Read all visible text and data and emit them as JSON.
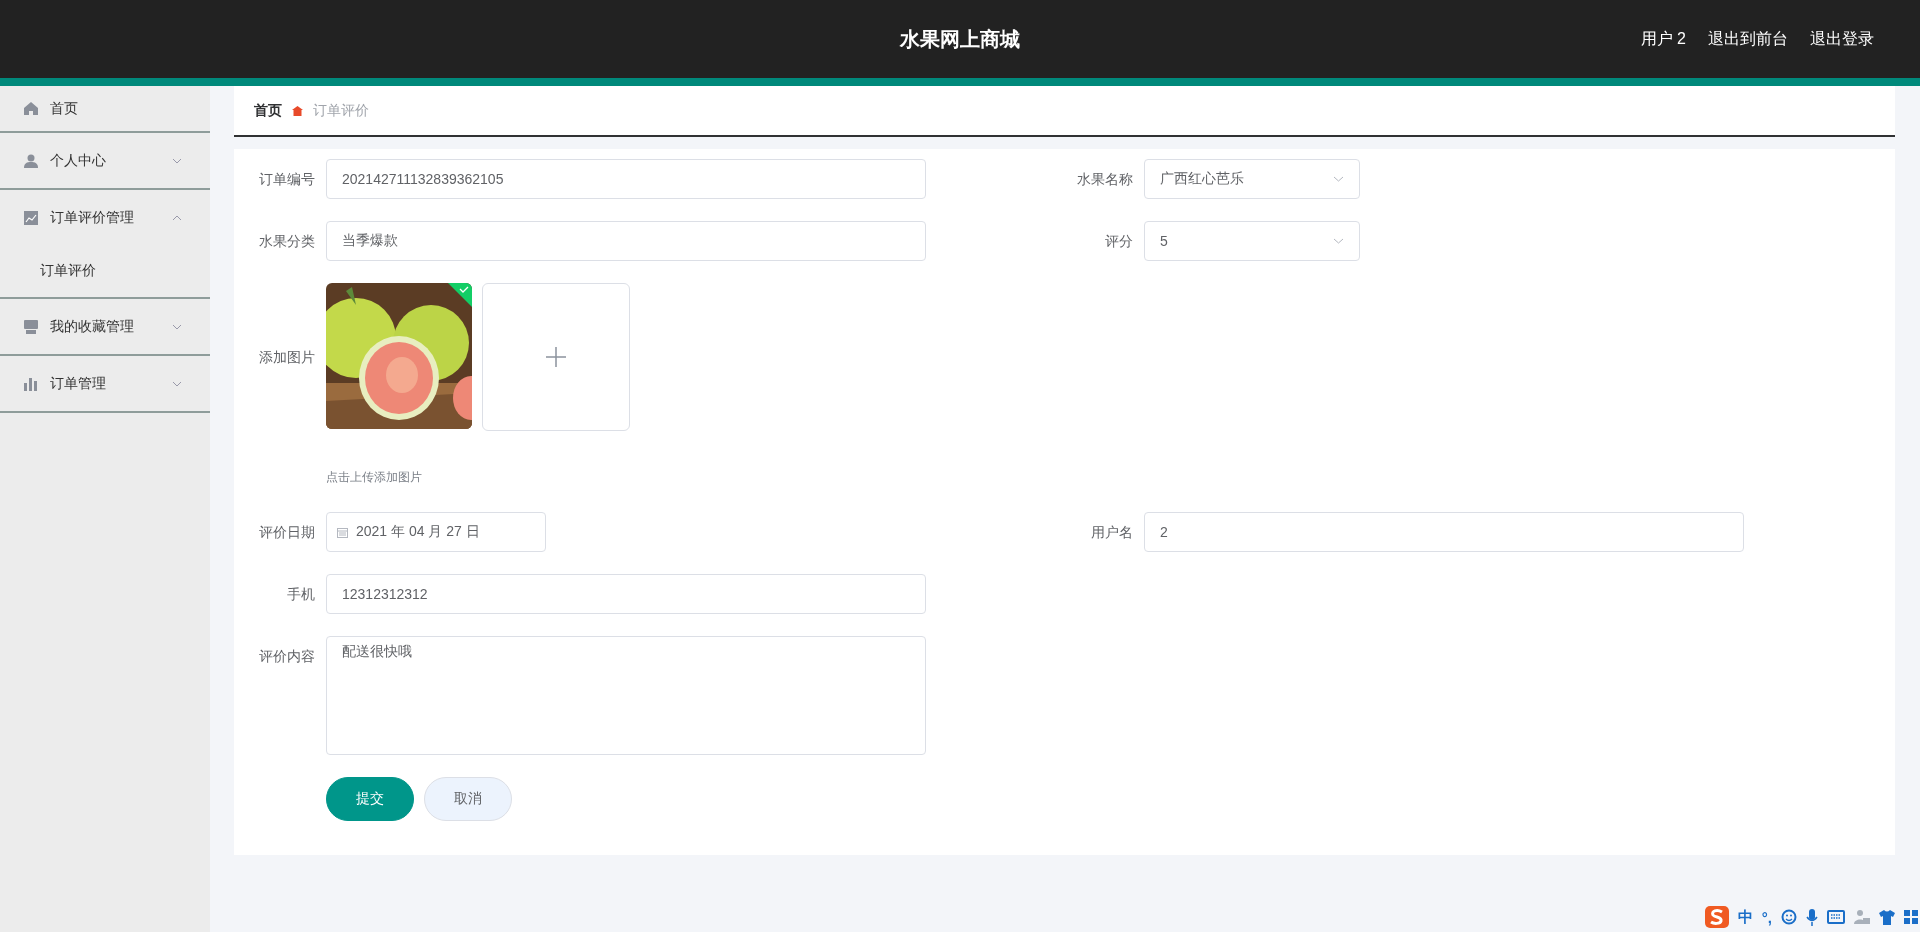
{
  "header": {
    "title": "水果网上商城",
    "links": [
      "用户 2",
      "退出到前台",
      "退出登录"
    ]
  },
  "sidebar": {
    "items": [
      {
        "kind": "link",
        "label": "首页"
      },
      {
        "kind": "menu",
        "label": "个人中心",
        "expanded": false
      },
      {
        "kind": "menu",
        "label": "订单评价管理",
        "expanded": true,
        "children": [
          {
            "label": "订单评价"
          }
        ]
      },
      {
        "kind": "menu",
        "label": "我的收藏管理",
        "expanded": false
      },
      {
        "kind": "menu",
        "label": "订单管理",
        "expanded": false
      }
    ]
  },
  "breadcrumb": [
    {
      "label": "首页",
      "current": false
    },
    {
      "label": "订单评价",
      "current": true
    }
  ],
  "form": {
    "rows": [
      {
        "fields": [
          {
            "kind": "text",
            "label": "订单编号",
            "value": "202142711132839362105"
          },
          {
            "kind": "select",
            "label": "水果名称",
            "value": "广西红心芭乐"
          }
        ]
      },
      {
        "fields": [
          {
            "kind": "text",
            "label": "水果分类",
            "value": "当季爆款"
          },
          {
            "kind": "select",
            "label": "评分",
            "value": "5"
          }
        ]
      },
      {
        "fields": [
          {
            "kind": "upload",
            "label": "添加图片",
            "images": [
              {
                "kind": "picture",
                "uploaded": true
              }
            ],
            "hint": "点击上传添加图片"
          }
        ]
      },
      {
        "fields": [
          {
            "kind": "date",
            "label": "评价日期",
            "value": "2021 年 04 月 27 日"
          },
          {
            "kind": "text",
            "label": "用户名",
            "value": "2"
          }
        ]
      },
      {
        "fields": [
          {
            "kind": "text",
            "label": "手机",
            "value": "12312312312"
          }
        ]
      },
      {
        "fields": [
          {
            "kind": "textarea",
            "label": "评价内容",
            "value": "配送很快哦"
          }
        ]
      }
    ],
    "buttons": [
      {
        "kind": "primary",
        "label": "提交"
      },
      {
        "kind": "default",
        "label": "取消"
      }
    ]
  },
  "ime_toolbar": {
    "mode": "中",
    "punctuation": "°,"
  }
}
